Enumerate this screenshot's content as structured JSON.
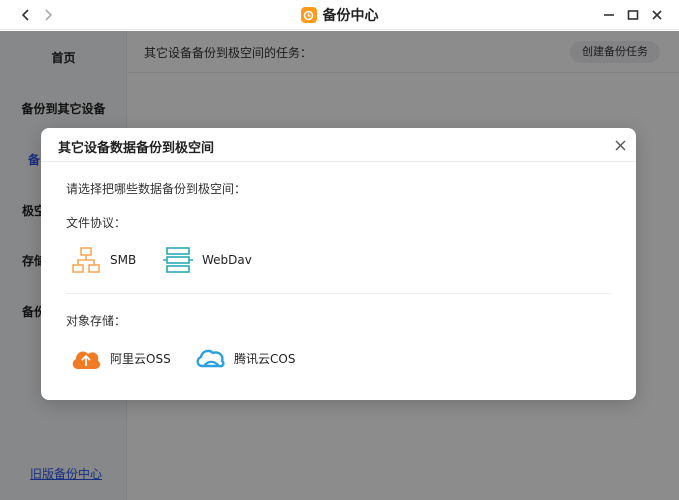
{
  "window": {
    "title": "备份中心",
    "back_icon": "chevron-left-icon",
    "forward_icon": "chevron-right-icon",
    "minimize_icon": "minimize-icon",
    "maximize_icon": "maximize-icon",
    "close_icon": "close-icon"
  },
  "sidebar": {
    "items": [
      {
        "label": "首页"
      },
      {
        "label": "备份到其它设备"
      },
      {
        "label": "备"
      },
      {
        "label": "极空"
      },
      {
        "label": "存储"
      },
      {
        "label": "备份"
      }
    ],
    "old_center_link": "旧版备份中心"
  },
  "main": {
    "header_text": "其它设备备份到极空间的任务：",
    "create_button": "创建备份任务"
  },
  "dialog": {
    "title": "其它设备数据备份到极空间",
    "prompt": "请选择把哪些数据备份到极空间：",
    "sections": [
      {
        "label": "文件协议：",
        "options": [
          {
            "label": "SMB",
            "icon": "network-share-icon"
          },
          {
            "label": "WebDav",
            "icon": "server-stack-icon"
          }
        ]
      },
      {
        "label": "对象存储：",
        "options": [
          {
            "label": "阿里云OSS",
            "icon": "cloud-upload-icon"
          },
          {
            "label": "腾讯云COS",
            "icon": "cloud-icon"
          }
        ]
      }
    ]
  },
  "colors": {
    "accent": "#2f54eb",
    "smb_orange": "#f7a85a",
    "webdav_teal": "#2aa9b5",
    "oss_orange": "#f07b24",
    "cos_blue": "#2ba0e0"
  }
}
